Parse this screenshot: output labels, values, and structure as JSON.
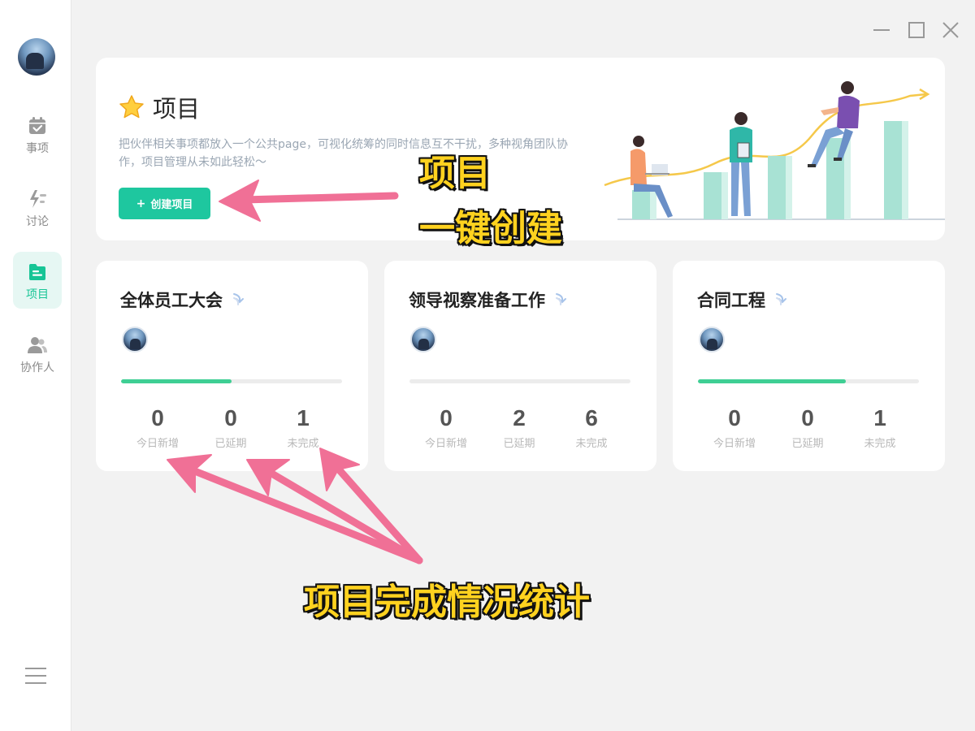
{
  "sidebar": {
    "items": [
      {
        "label": "事项",
        "icon": "calendar-check-icon",
        "active": false
      },
      {
        "label": "讨论",
        "icon": "lightning-icon",
        "active": false
      },
      {
        "label": "项目",
        "icon": "folder-icon",
        "active": true
      },
      {
        "label": "协作人",
        "icon": "people-icon",
        "active": false
      }
    ],
    "menu_icon": "hamburger-menu-icon"
  },
  "window_controls": [
    "minimize-icon",
    "maximize-icon",
    "close-icon"
  ],
  "hero": {
    "title": "项目",
    "title_icon": "star-icon",
    "description": "把伙伴相关事项都放入一个公共page，可视化统筹的同时信息互不干扰，多种视角团队协作，项目管理从未如此轻松～",
    "create_button": {
      "plus": "+",
      "label": "创建项目"
    }
  },
  "projects": [
    {
      "title": "全体员工大会",
      "progress": 0.5,
      "stats": [
        {
          "value": "0",
          "label": "今日新增"
        },
        {
          "value": "0",
          "label": "已延期"
        },
        {
          "value": "1",
          "label": "未完成"
        }
      ]
    },
    {
      "title": "领导视察准备工作",
      "progress": 0,
      "stats": [
        {
          "value": "0",
          "label": "今日新增"
        },
        {
          "value": "2",
          "label": "已延期"
        },
        {
          "value": "6",
          "label": "未完成"
        }
      ]
    },
    {
      "title": "合同工程",
      "progress": 0.67,
      "stats": [
        {
          "value": "0",
          "label": "今日新增"
        },
        {
          "value": "0",
          "label": "已延期"
        },
        {
          "value": "1",
          "label": "未完成"
        }
      ]
    }
  ],
  "annotations": {
    "line1": "项目",
    "line2": "一键创建",
    "line3": "项目完成情况统计"
  },
  "colors": {
    "accent": "#1ec79f",
    "progress": "#3fcf94",
    "annotation_text": "#ffd21f",
    "annotation_arrow": "#f07096"
  }
}
